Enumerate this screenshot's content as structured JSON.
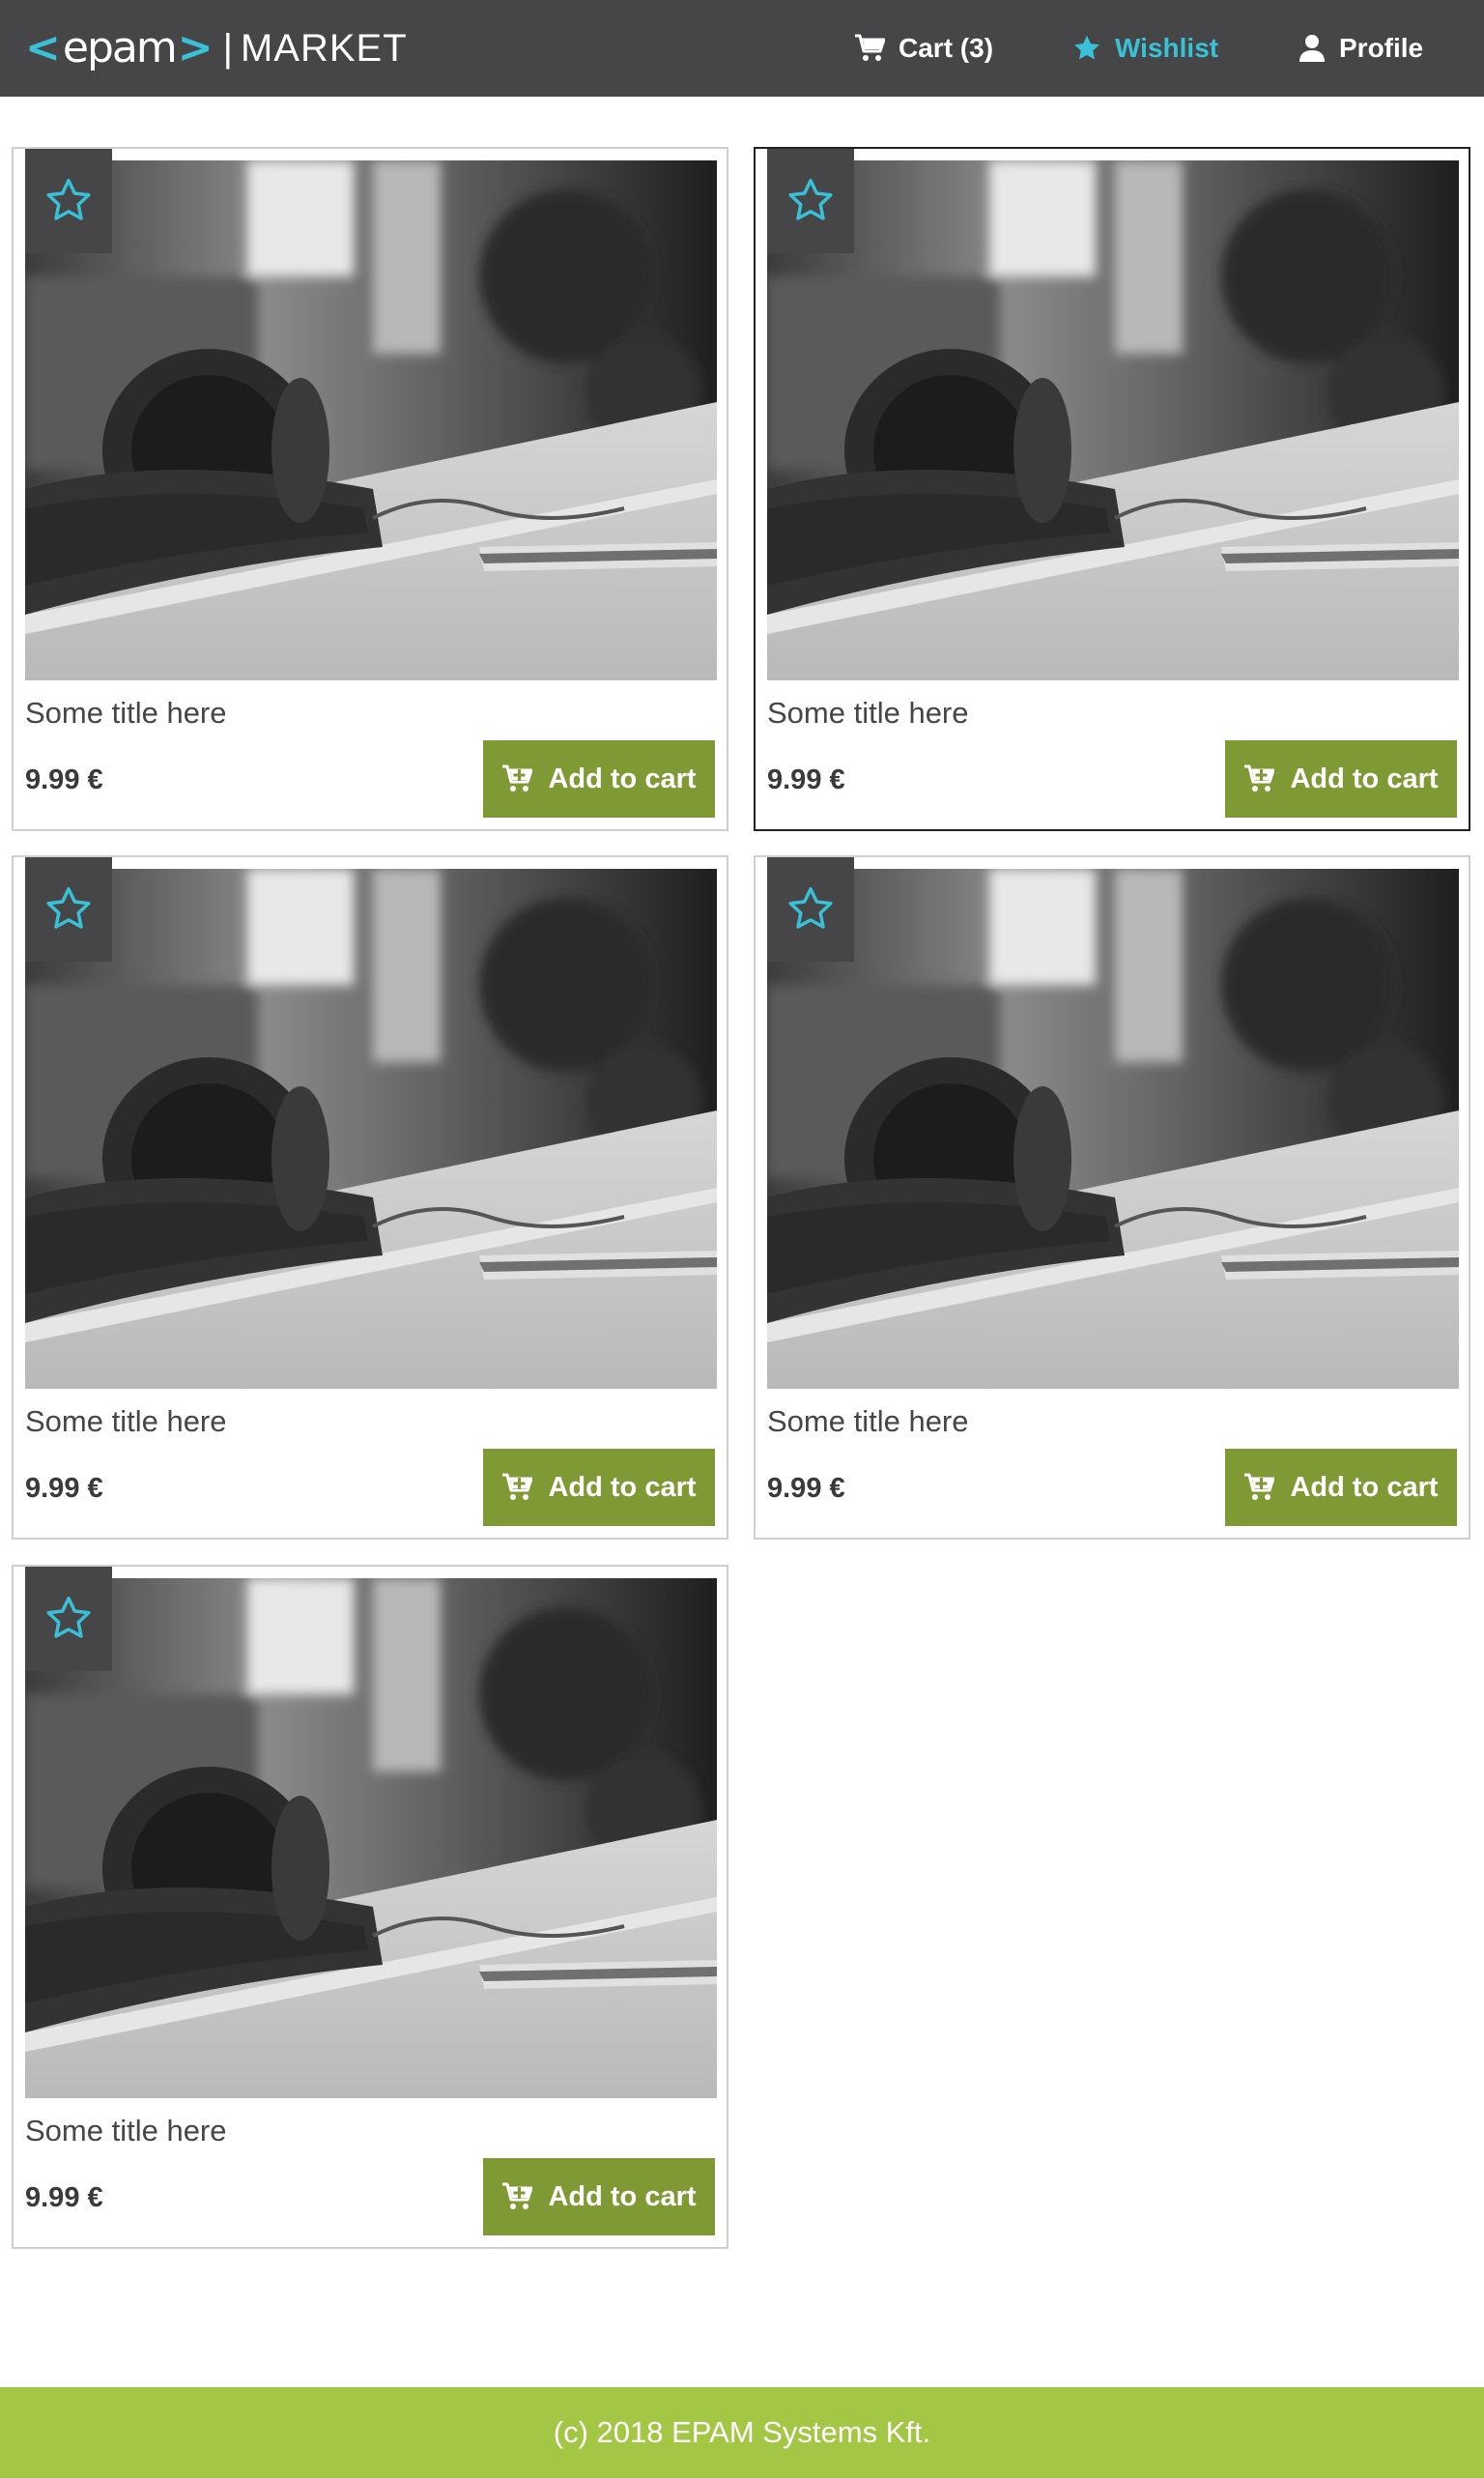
{
  "header": {
    "logo": {
      "bracket_left": "<",
      "word": "epam",
      "bracket_right": ">",
      "separator": "|",
      "market": "MARKET"
    },
    "nav": {
      "cart_label": "Cart (3)",
      "wishlist_label": "Wishlist",
      "profile_label": "Profile"
    },
    "colors": {
      "background": "#464547",
      "accent": "#39c2d7"
    }
  },
  "products": [
    {
      "title": "Some title here",
      "price": "9.99 €",
      "add_label": "Add to cart",
      "favorite_icon": "star-outline-icon",
      "selected": false
    },
    {
      "title": "Some title here",
      "price": "9.99 €",
      "add_label": "Add to cart",
      "favorite_icon": "star-outline-icon",
      "selected": true
    },
    {
      "title": "Some title here",
      "price": "9.99 €",
      "add_label": "Add to cart",
      "favorite_icon": "star-outline-icon",
      "selected": false
    },
    {
      "title": "Some title here",
      "price": "9.99 €",
      "add_label": "Add to cart",
      "favorite_icon": "star-outline-icon",
      "selected": false
    },
    {
      "title": "Some title here",
      "price": "9.99 €",
      "add_label": "Add to cart",
      "favorite_icon": "star-outline-icon",
      "selected": false
    }
  ],
  "colors": {
    "add_button": "#7f9a35",
    "footer": "#a3c644"
  },
  "footer": {
    "text": "(c) 2018 EPAM Systems Kft."
  }
}
